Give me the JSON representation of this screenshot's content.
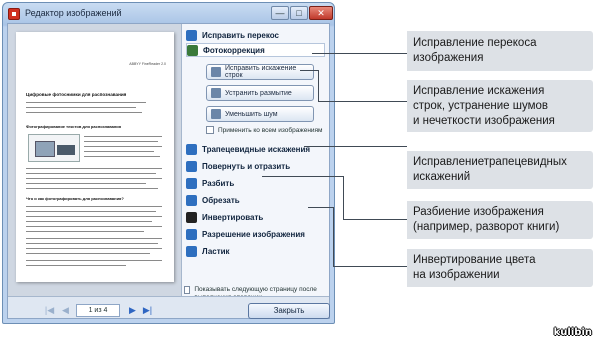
{
  "window": {
    "title": "Редактор изображений",
    "controls": {
      "minimize": "—",
      "maximize": "□",
      "close": "✕"
    }
  },
  "preview": {
    "header": "ABBYY FineReader 2.0",
    "heading": "Цифровые фотоснимки для распознавания",
    "subheading": "Фотографирование текстов для распознавания",
    "question": "Что и как фотографировать для распознавания?"
  },
  "panel": {
    "commands": [
      {
        "label": "Исправить перекос",
        "icon": "skew-correct-icon",
        "color": "#2e6fbf"
      },
      {
        "label": "Фотокоррекция",
        "icon": "photo-correction-icon",
        "color": "#3a7a3a"
      }
    ],
    "sub_buttons": [
      {
        "label": "Исправить искажение строк",
        "icon": "straighten-lines-icon"
      },
      {
        "label": "Устранить размытие",
        "icon": "deblur-icon"
      },
      {
        "label": "Уменьшить шум",
        "icon": "denoise-icon"
      }
    ],
    "apply_all": "Применить ко всем изображениям",
    "tools": [
      {
        "label": "Трапецевидные искажения",
        "icon": "trapezoid-icon",
        "color": "#2e6fbf"
      },
      {
        "label": "Повернуть и отразить",
        "icon": "rotate-icon",
        "color": "#2e6fbf"
      },
      {
        "label": "Разбить",
        "icon": "split-icon",
        "color": "#2e6fbf"
      },
      {
        "label": "Обрезать",
        "icon": "crop-icon",
        "color": "#2e6fbf"
      },
      {
        "label": "Инвертировать",
        "icon": "invert-icon",
        "color": "#222222"
      },
      {
        "label": "Разрешение изображения",
        "icon": "resolution-icon",
        "color": "#2e6fbf"
      },
      {
        "label": "Ластик",
        "icon": "eraser-icon",
        "color": "#2e6fbf"
      }
    ],
    "show_next": "Показывать следующую страницу после выполнения операции"
  },
  "nav": {
    "first": "|◀",
    "prev": "◀",
    "page_indicator": "1 из 4",
    "next": "▶",
    "last": "▶|",
    "close": "Закрыть"
  },
  "callouts": [
    "Исправление перекоса\nизображения",
    "Исправление искажения\nстрок, устранение шумов\nи нечеткости изображения",
    "Исправлениетрапецевидных\nискажений",
    "Разбиение изображения\n(например, разворот книги)",
    "Инвертирование цвета\nна изображении"
  ],
  "watermark": "kulibin"
}
